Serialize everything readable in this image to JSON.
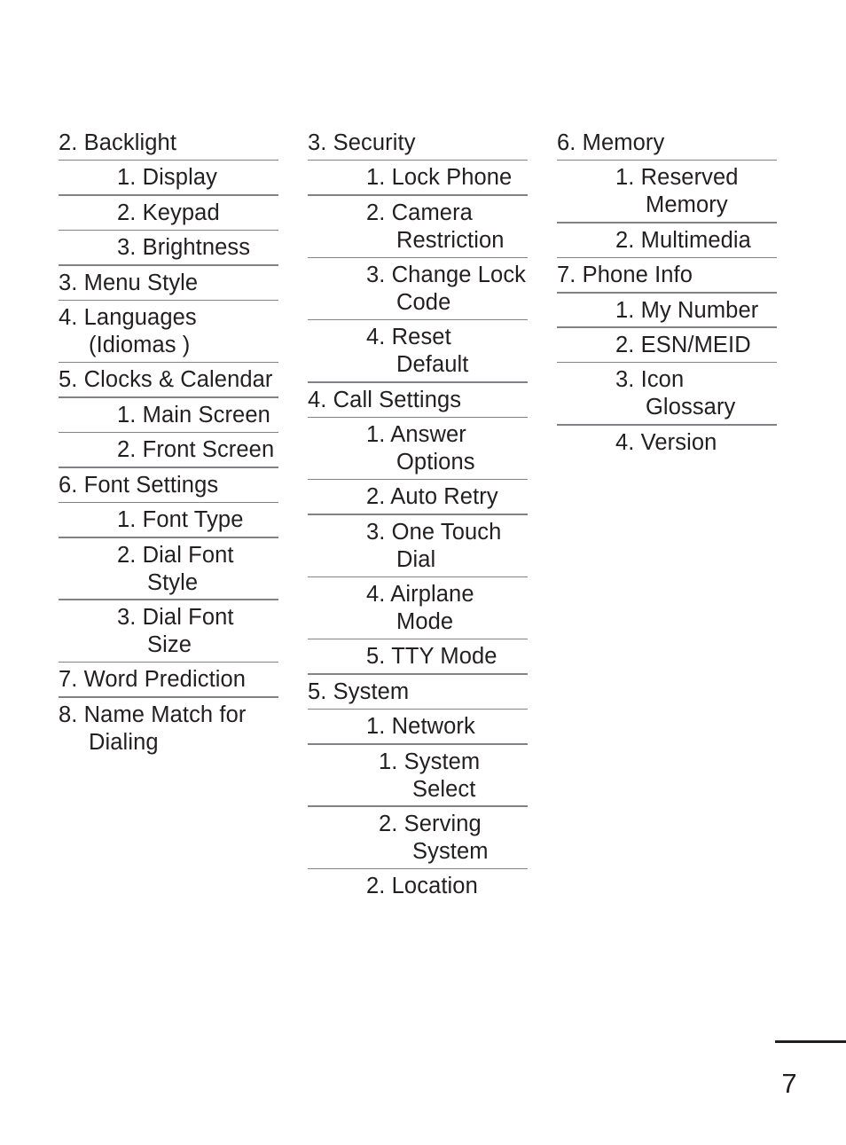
{
  "page": {
    "number": "7",
    "kind": "menu-tree-table-of-contents",
    "rule_color": "#808285",
    "text_color": "#231f20",
    "background_color": "#ffffff"
  },
  "columns": [
    {
      "id": "column-1",
      "rows": [
        {
          "level": 1,
          "text": "2. Backlight"
        },
        {
          "level": 2,
          "text": "1. Display"
        },
        {
          "level": 2,
          "text": "2. Keypad"
        },
        {
          "level": 2,
          "text": "3. Brightness"
        },
        {
          "level": 1,
          "text": "3. Menu Style"
        },
        {
          "level": 1,
          "text": "4. Languages (Idiomas )"
        },
        {
          "level": 1,
          "text": "5. Clocks & Calendar"
        },
        {
          "level": 2,
          "text": "1. Main Screen"
        },
        {
          "level": 2,
          "text": "2. Front Screen"
        },
        {
          "level": 1,
          "text": "6. Font Settings"
        },
        {
          "level": 2,
          "text": "1. Font Type"
        },
        {
          "level": 2,
          "text": "2. Dial Font Style"
        },
        {
          "level": 2,
          "text": "3. Dial Font Size"
        },
        {
          "level": 1,
          "text": "7. Word Prediction"
        },
        {
          "level": 1,
          "text": "8. Name Match for Dialing",
          "last": true
        }
      ]
    },
    {
      "id": "column-2",
      "rows": [
        {
          "level": 1,
          "text": "3. Security"
        },
        {
          "level": 2,
          "text": "1. Lock Phone"
        },
        {
          "level": 2,
          "text": "2. Camera Restriction"
        },
        {
          "level": 2,
          "text": "3. Change Lock Code"
        },
        {
          "level": 2,
          "text": "4. Reset Default"
        },
        {
          "level": 1,
          "text": "4. Call Settings"
        },
        {
          "level": 2,
          "text": "1. Answer Options"
        },
        {
          "level": 2,
          "text": "2. Auto Retry"
        },
        {
          "level": 2,
          "text": "3. One Touch Dial"
        },
        {
          "level": 2,
          "text": "4. Airplane Mode"
        },
        {
          "level": 2,
          "text": "5. TTY Mode"
        },
        {
          "level": 1,
          "text": "5. System"
        },
        {
          "level": 2,
          "text": "1. Network"
        },
        {
          "level": 3,
          "text": "1. System Select"
        },
        {
          "level": 3,
          "text": "2. Serving System"
        },
        {
          "level": 2,
          "text": "2. Location",
          "last": true
        }
      ]
    },
    {
      "id": "column-3",
      "rows": [
        {
          "level": 1,
          "text": "6. Memory"
        },
        {
          "level": 2,
          "text": "1. Reserved Memory"
        },
        {
          "level": 2,
          "text": "2. Multimedia"
        },
        {
          "level": 1,
          "text": "7. Phone Info"
        },
        {
          "level": 2,
          "text": "1. My Number"
        },
        {
          "level": 2,
          "text": "2. ESN/MEID"
        },
        {
          "level": 2,
          "text": "3. Icon Glossary"
        },
        {
          "level": 2,
          "text": "4. Version",
          "last": true
        }
      ]
    }
  ]
}
